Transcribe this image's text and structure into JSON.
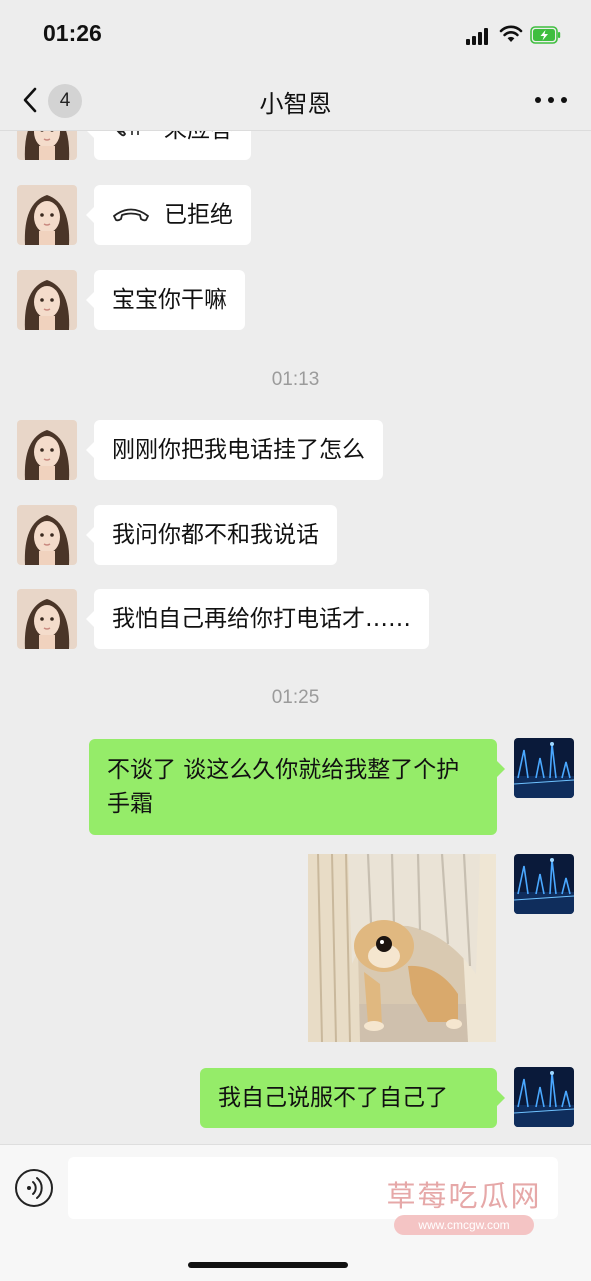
{
  "status_bar": {
    "time": "01:26"
  },
  "header": {
    "back_badge": "4",
    "title": "小智恩"
  },
  "messages": {
    "m0": {
      "text": "未应答",
      "icon": "phone-icon"
    },
    "m1": {
      "text": "已拒绝",
      "icon": "phone-hangup-icon"
    },
    "m2": {
      "text": "宝宝你干嘛"
    },
    "ts1": "01:13",
    "m3": {
      "text": "刚刚你把我电话挂了怎么"
    },
    "m4": {
      "text": "我问你都不和我说话"
    },
    "m5": {
      "text": "我怕自己再给你打电话才……"
    },
    "ts2": "01:25",
    "m6": {
      "text": "不谈了 谈这么久你就给我整了个护手霜"
    },
    "m7": {
      "type": "sticker"
    },
    "m8": {
      "text": "我自己说服不了自己了"
    }
  },
  "input": {
    "placeholder": ""
  },
  "watermark": {
    "title": "草莓吃瓜网",
    "url": "www.cmcgw.com"
  },
  "colors": {
    "background": "#ededed",
    "incoming_bubble": "#ffffff",
    "outgoing_bubble": "#95ec69",
    "timestamp": "#9b9b9b"
  }
}
